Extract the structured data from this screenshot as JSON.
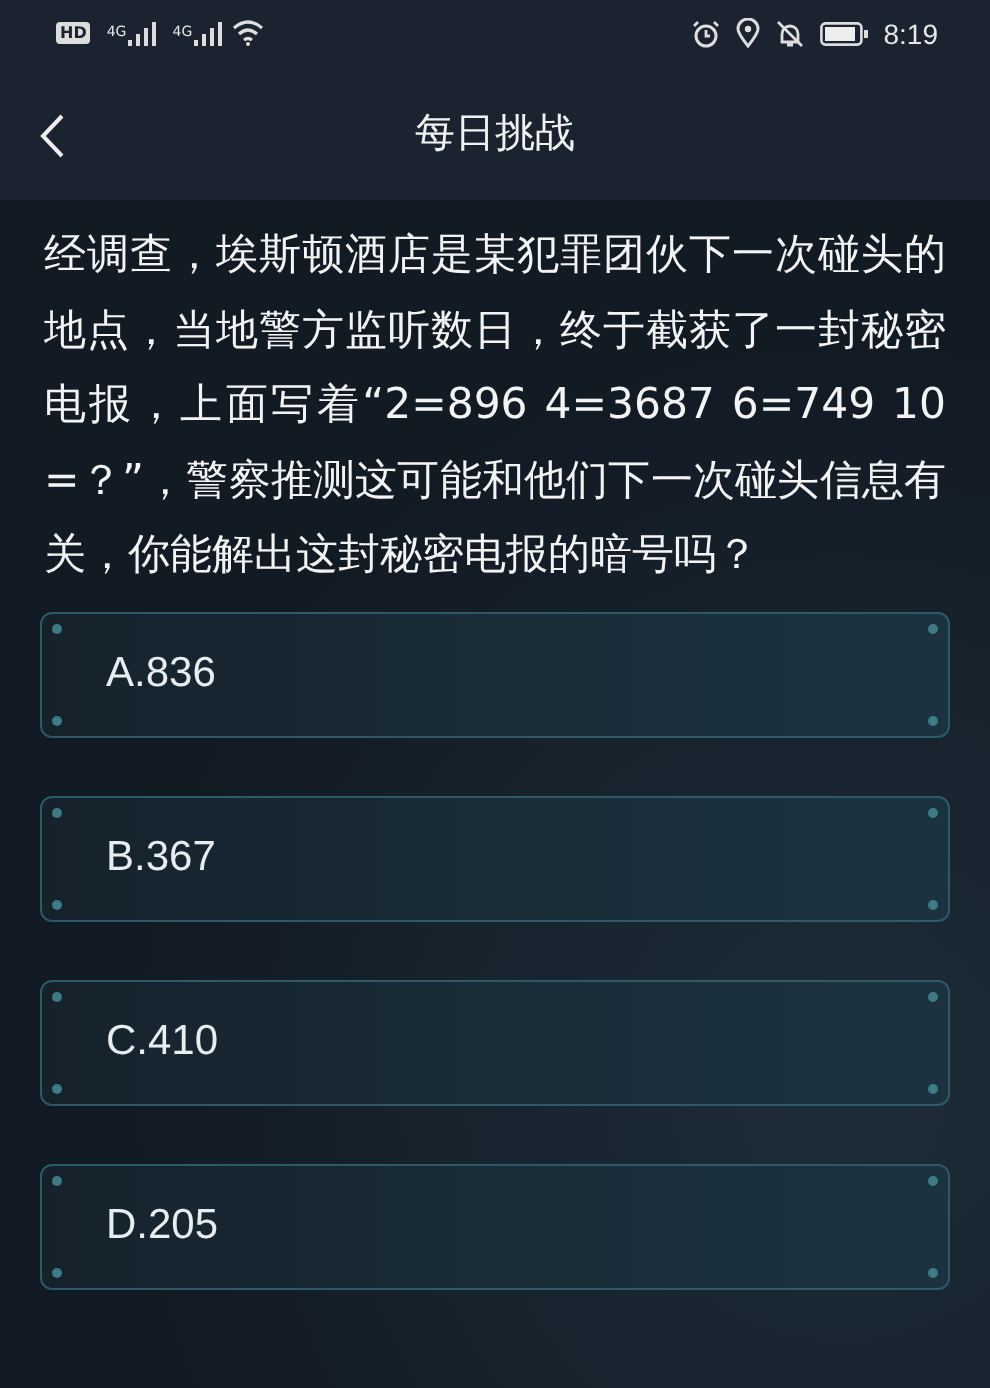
{
  "status_bar": {
    "hd": "HD",
    "networks": [
      "4G",
      "4G"
    ],
    "time": "8:19"
  },
  "header": {
    "title": "每日挑战"
  },
  "question": "经调查，埃斯顿酒店是某犯罪团伙下一次碰头的地点，当地警方监听数日，终于截获了一封秘密电报，上面写着“2=896 4=3687 6=749 10=？”，警察推测这可能和他们下一次碰头信息有关，你能解出这封秘密电报的暗号吗？",
  "options": [
    {
      "label": "A.836"
    },
    {
      "label": "B.367"
    },
    {
      "label": "C.410"
    },
    {
      "label": "D.205"
    }
  ]
}
